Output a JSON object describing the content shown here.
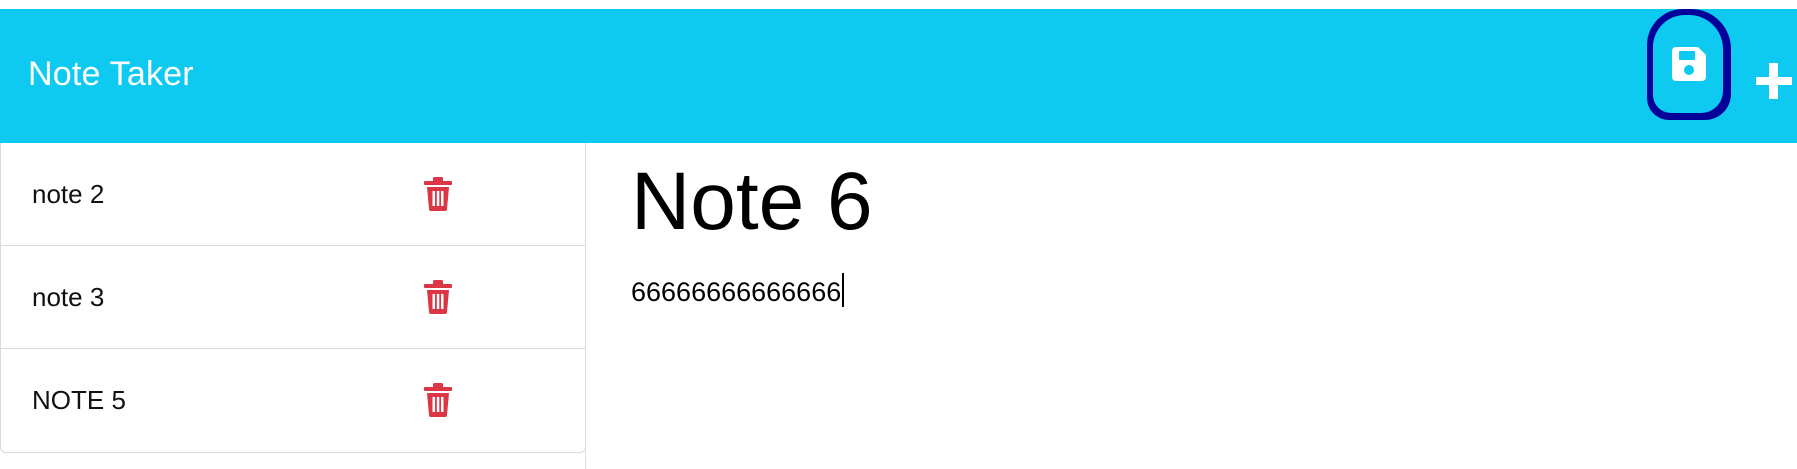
{
  "app": {
    "title": "Note Taker"
  },
  "toolbar": {
    "save_icon": "save-icon",
    "add_icon": "plus-icon"
  },
  "notes": [
    {
      "title": "note 2",
      "delete_icon": "trash-icon"
    },
    {
      "title": "note 3",
      "delete_icon": "trash-icon"
    },
    {
      "title": "NOTE 5",
      "delete_icon": "trash-icon"
    }
  ],
  "editor": {
    "title": "Note 6",
    "body": "66666666666666"
  },
  "colors": {
    "navbar": "#0fcaf0",
    "trash": "#dc3545",
    "save_highlight": "#02029a"
  }
}
